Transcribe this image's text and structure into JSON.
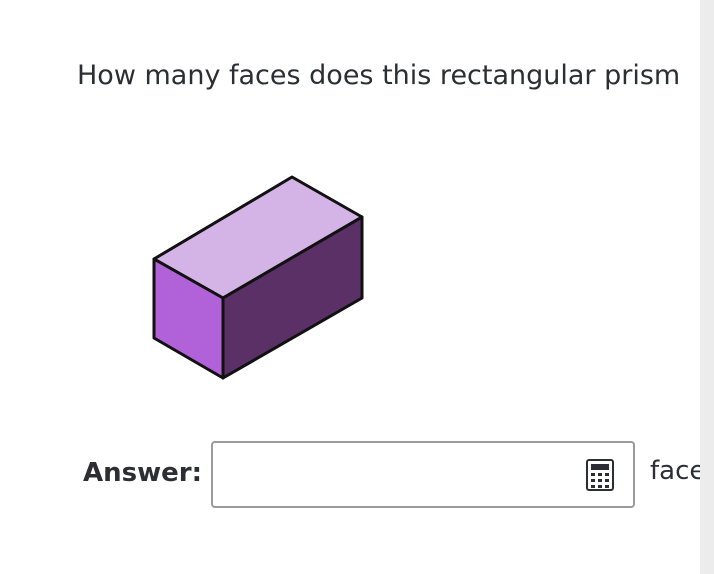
{
  "question": {
    "text": "How many faces does this rectangular prism have?"
  },
  "figure": {
    "shape": "rectangular prism",
    "colors": {
      "top": "#d4b3e7",
      "front": "#b162d8",
      "side": "#5a3066",
      "outline": "#111111"
    }
  },
  "answer": {
    "label": "Answer:",
    "value": "",
    "placeholder": "",
    "unit": "faces",
    "icon": "calculator-icon"
  }
}
